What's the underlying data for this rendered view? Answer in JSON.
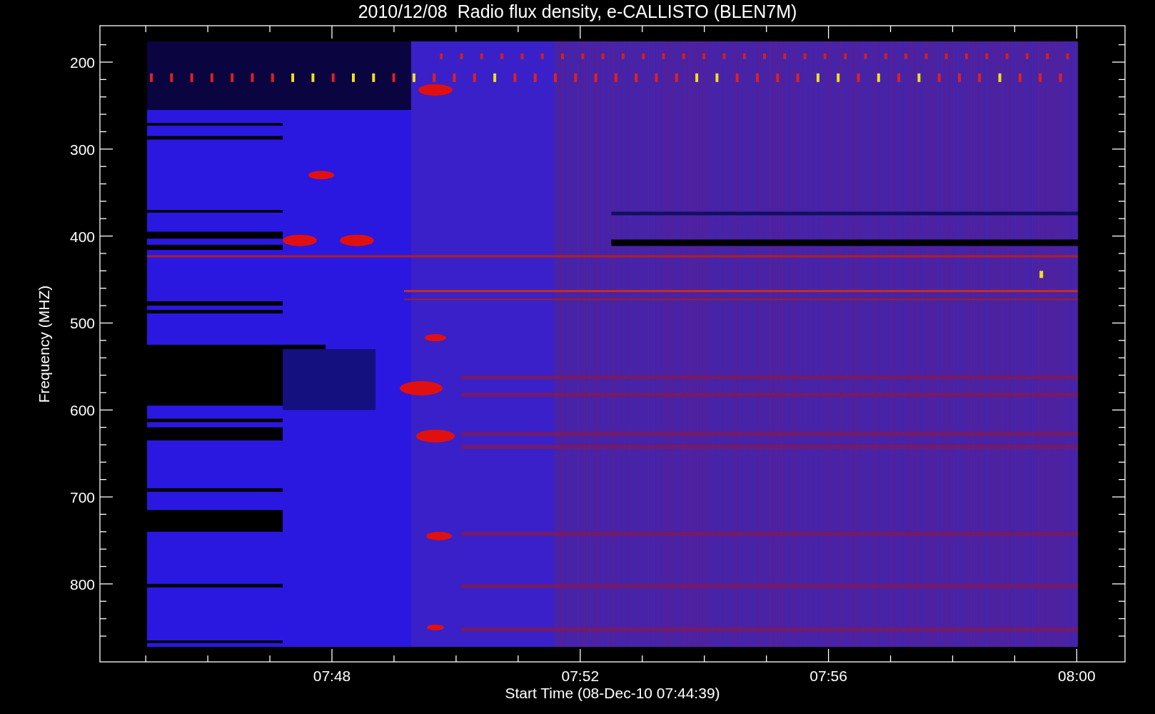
{
  "title": "2010/12/08  Radio flux density, e-CALLISTO (BLEN7M)",
  "y_axis": {
    "label": "Frequency (MHZ)",
    "ticks": [
      "200",
      "300",
      "400",
      "500",
      "600",
      "700",
      "800"
    ]
  },
  "x_axis": {
    "label": "Start Time (08-Dec-10 07:44:39)",
    "ticks": [
      "07:48",
      "07:52",
      "07:56",
      "08:00"
    ]
  }
}
